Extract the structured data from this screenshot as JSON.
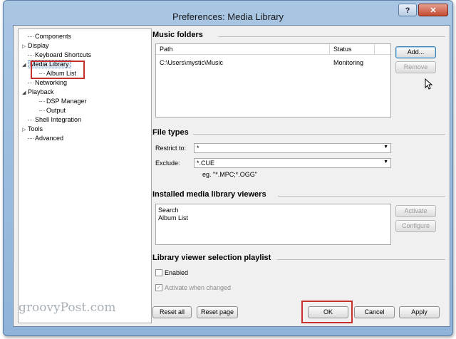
{
  "window": {
    "title": "Preferences: Media Library",
    "help_label": "?",
    "close_label": "✕"
  },
  "tree": {
    "items": [
      {
        "label": "Components",
        "level": 0,
        "expander": ""
      },
      {
        "label": "Display",
        "level": 0,
        "expander": "▷"
      },
      {
        "label": "Keyboard Shortcuts",
        "level": 0,
        "expander": ""
      },
      {
        "label": "Media Library",
        "level": 0,
        "expander": "◢"
      },
      {
        "label": "Album List",
        "level": 1,
        "expander": ""
      },
      {
        "label": "Networking",
        "level": 0,
        "expander": ""
      },
      {
        "label": "Playback",
        "level": 0,
        "expander": "◢"
      },
      {
        "label": "DSP Manager",
        "level": 1,
        "expander": ""
      },
      {
        "label": "Output",
        "level": 1,
        "expander": ""
      },
      {
        "label": "Shell Integration",
        "level": 0,
        "expander": ""
      },
      {
        "label": "Tools",
        "level": 0,
        "expander": "▷"
      },
      {
        "label": "Advanced",
        "level": 0,
        "expander": ""
      }
    ]
  },
  "music_folders": {
    "title": "Music folders",
    "columns": [
      "Path",
      "Status"
    ],
    "rows": [
      {
        "path": "C:\\Users\\mystic\\Music",
        "status": "Monitoring"
      }
    ],
    "add_label": "Add...",
    "remove_label": "Remove"
  },
  "file_types": {
    "title": "File types",
    "restrict_label": "Restrict to:",
    "restrict_value": "*",
    "exclude_label": "Exclude:",
    "exclude_value": "*.CUE",
    "hint": "eg. \"*.MPC;*.OGG\""
  },
  "viewers": {
    "title": "Installed media library viewers",
    "items": [
      "Search",
      "Album List"
    ],
    "activate_label": "Activate",
    "configure_label": "Configure"
  },
  "playlist": {
    "title": "Library viewer selection playlist",
    "enabled_label": "Enabled",
    "activate_changed_label": "Activate when changed"
  },
  "footer": {
    "reset_all": "Reset all",
    "reset_page": "Reset page",
    "ok": "OK",
    "cancel": "Cancel",
    "apply": "Apply"
  },
  "watermark": "groovyPost.com",
  "colors": {
    "highlight_box": "#c9302c",
    "title_bar": "#a9c6e3",
    "close_button": "#c44a32"
  }
}
